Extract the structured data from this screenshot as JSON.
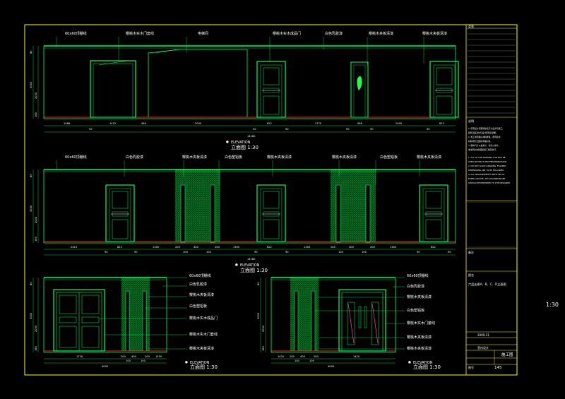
{
  "scale_side": "1:30",
  "elevation_word": "ELEVATION",
  "elev1": {
    "title": "立面图  1:30",
    "labels": [
      "60x60顶棚线",
      "樱桃木实木门套线",
      "电梯间",
      "樱桃木实木成品门",
      "白色乳胶漆",
      "樱桃木夹板清漆",
      "樱桃木夹板清漆"
    ],
    "bottom_dims": [
      "1066",
      "90",
      "1422",
      "484",
      "2000",
      "90",
      "822",
      "90",
      "2770",
      "90",
      "568",
      "90",
      "2000",
      "90",
      "822"
    ],
    "total": "14180",
    "height_dims": [
      "80",
      "3000",
      "2000",
      "160"
    ]
  },
  "elev2": {
    "title": "立面图  1:30",
    "labels": [
      "60x60顶棚线",
      "白色乳胶漆",
      "樱桃木夹板清漆",
      "白色塑铝板",
      "樱桃木夹板清漆",
      "樱桃木夹板清漆",
      "白色塑铝板",
      "樱桃木夹板清漆"
    ],
    "bottom_dims": [
      "2313",
      "90",
      "822",
      "90",
      "1300",
      "200",
      "100",
      "400",
      "100",
      "200",
      "1300",
      "90",
      "822",
      "90",
      "1300",
      "200",
      "100",
      "400",
      "100",
      "200",
      "1300",
      "90",
      "822",
      "90"
    ],
    "total": "14180",
    "height_dims": [
      "80",
      "3000",
      "2000",
      "160"
    ]
  },
  "elev3": {
    "title": "立面图  1:30",
    "labels": [
      "60x60顶棚线",
      "白色乳胶漆",
      "樱桃木夹板清漆",
      "白色塑铝板",
      "樱桃木实木成品门",
      "樱桃木实木门套线",
      "樱桃木夹板清漆"
    ],
    "bottom_dims": [
      "1720",
      "200",
      "100",
      "400",
      "100",
      "200",
      "1550"
    ],
    "total": "4000",
    "height_dims": [
      "80",
      "3000",
      "2000",
      "160"
    ]
  },
  "elev4": {
    "title": "立面图  1:30",
    "labels": [
      "60x60顶棚线",
      "白色乳胶漆",
      "樱桃木夹板清漆",
      "白色塑铝板",
      "樱桃木实木门套线",
      "樱桃木夹板清漆",
      "樱桃木夹板清漆"
    ],
    "bottom_dims": [
      "1420",
      "200",
      "100",
      "400",
      "100",
      "200",
      "1420"
    ],
    "total": "4000",
    "height_dims": [
      "80",
      "3000",
      "2000",
      "160"
    ]
  },
  "title_block": {
    "header": "会签",
    "notes_title": "说明",
    "notes_cn": [
      "1. 所有设计须现场复核尺寸后方可施工，",
      "   如有误差及时与设计师联系调整。",
      "2. 施工前须确认材料样板，所有装饰",
      "   材料须符合国家环保标准。",
      "3. 图中尺寸以毫米计，标高以米计，",
      "   未注明之处按国家施工规范执行。"
    ],
    "notes_en": [
      "1. ALL OF THE DRAWING CAN NOT BE",
      "USED WITHOUT WRITTEN PERMISSION.",
      "2. DO NOT SCALE DRAWING. FIGURED",
      "DIMENSIONS ARE TO BE FOLLOWED.",
      "3. ALL MEASUREMENTS MUST BE CH-",
      "ECKED ON SITE. ANY DISCREPANCIES",
      "SHOULD BE REPORTED TO THE DESIGNER."
    ],
    "remark": "备注",
    "drawing_name_label": "图名",
    "drawing_name": "六层走廊A、B、C、D立面图",
    "date": "2009-11",
    "design_label": "室内设计",
    "stage": "施工图",
    "sheet_label": "图号",
    "sheet_no": "145"
  },
  "colors": {
    "line": "#00ff66",
    "wall": "#00cc44",
    "border": "#ffff00",
    "text": "#ffffff",
    "base": "#ff2222",
    "glass": "#ff3399",
    "dim": "#00ffff"
  }
}
